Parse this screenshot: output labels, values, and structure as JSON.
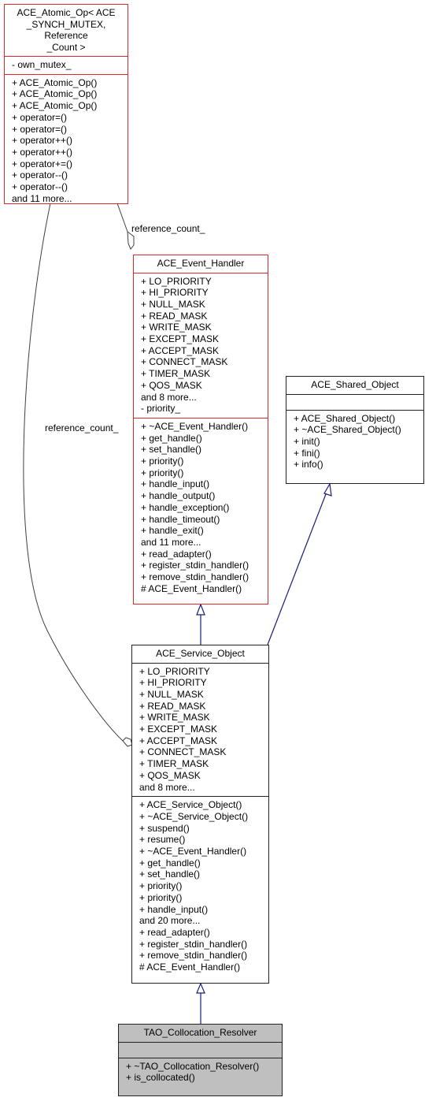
{
  "classes": {
    "atomic_op": {
      "title": "ACE_Atomic_Op< ACE\n_SYNCH_MUTEX, Reference\n_Count >",
      "attributes": [
        "- own_mutex_"
      ],
      "methods": [
        "+ ACE_Atomic_Op()",
        "+ ACE_Atomic_Op()",
        "+ ACE_Atomic_Op()",
        "+ operator=()",
        "+ operator=()",
        "+ operator++()",
        "+ operator++()",
        "+ operator+=()",
        "+ operator--()",
        "+ operator--()",
        "and 11 more..."
      ]
    },
    "event_handler": {
      "title": "ACE_Event_Handler",
      "attributes": [
        "+ LO_PRIORITY",
        "+ HI_PRIORITY",
        "+ NULL_MASK",
        "+ READ_MASK",
        "+ WRITE_MASK",
        "+ EXCEPT_MASK",
        "+ ACCEPT_MASK",
        "+ CONNECT_MASK",
        "+ TIMER_MASK",
        "+ QOS_MASK",
        "and 8 more...",
        "- priority_"
      ],
      "methods": [
        "+ ~ACE_Event_Handler()",
        "+ get_handle()",
        "+ set_handle()",
        "+ priority()",
        "+ priority()",
        "+ handle_input()",
        "+ handle_output()",
        "+ handle_exception()",
        "+ handle_timeout()",
        "+ handle_exit()",
        "and 11 more...",
        "+ read_adapter()",
        "+ register_stdin_handler()",
        "+ remove_stdin_handler()",
        "# ACE_Event_Handler()"
      ]
    },
    "shared_object": {
      "title": "ACE_Shared_Object",
      "attributes": [],
      "methods": [
        "+ ACE_Shared_Object()",
        "+ ~ACE_Shared_Object()",
        "+ init()",
        "+ fini()",
        "+ info()"
      ]
    },
    "service_object": {
      "title": "ACE_Service_Object",
      "attributes": [
        "+ LO_PRIORITY",
        "+ HI_PRIORITY",
        "+ NULL_MASK",
        "+ READ_MASK",
        "+ WRITE_MASK",
        "+ EXCEPT_MASK",
        "+ ACCEPT_MASK",
        "+ CONNECT_MASK",
        "+ TIMER_MASK",
        "+ QOS_MASK",
        "and 8 more..."
      ],
      "methods": [
        "+ ACE_Service_Object()",
        "+ ~ACE_Service_Object()",
        "+ suspend()",
        "+ resume()",
        "+ ~ACE_Event_Handler()",
        "+ get_handle()",
        "+ set_handle()",
        "+ priority()",
        "+ priority()",
        "+ handle_input()",
        "and 20 more...",
        "+ read_adapter()",
        "+ register_stdin_handler()",
        "+ remove_stdin_handler()",
        "# ACE_Event_Handler()"
      ]
    },
    "collocation_resolver": {
      "title": "TAO_Collocation_Resolver",
      "attributes": [],
      "methods": [
        "+ ~TAO_Collocation_Resolver()",
        "+ is_collocated()"
      ]
    }
  },
  "edge_labels": {
    "ref_count_event_handler": "reference_count_",
    "ref_count_service_object": "reference_count_"
  },
  "colors": {
    "highlight_border": "#e0262a",
    "inheritance_edge": "#1a1a7a",
    "usage_edge": "#404040",
    "focus_fill": "#bfbfbf"
  }
}
